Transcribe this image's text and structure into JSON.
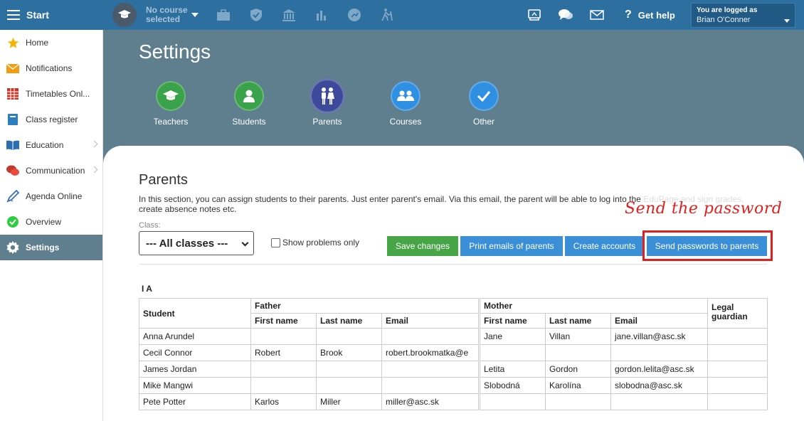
{
  "topbar": {
    "start_label": "Start",
    "course_line1": "No course",
    "course_line2": "selected",
    "help_label": "Get help",
    "login_line1": "You are logged as",
    "login_line2": "Brian O'Conner"
  },
  "sidebar": {
    "items": [
      {
        "label": "Home",
        "icon": "star-icon"
      },
      {
        "label": "Notifications",
        "icon": "envelope-icon"
      },
      {
        "label": "Timetables Onl...",
        "icon": "calendar-icon"
      },
      {
        "label": "Class register",
        "icon": "notebook-icon"
      },
      {
        "label": "Education",
        "icon": "book-icon"
      },
      {
        "label": "Communication",
        "icon": "chat-icon"
      },
      {
        "label": "Agenda Online",
        "icon": "pen-icon"
      },
      {
        "label": "Overview",
        "icon": "check-circle-icon"
      },
      {
        "label": "Settings",
        "icon": "gear-icon"
      }
    ]
  },
  "header": {
    "title": "Settings",
    "categories": [
      {
        "label": "Teachers",
        "icon": "graduation-cap-icon",
        "color": "#3aa24a"
      },
      {
        "label": "Students",
        "icon": "person-icon",
        "color": "#3aa24a"
      },
      {
        "label": "Parents",
        "icon": "parents-icon",
        "color": "#3d4a9c"
      },
      {
        "label": "Courses",
        "icon": "group-icon",
        "color": "#2f8fe0"
      },
      {
        "label": "Other",
        "icon": "checkmark-icon",
        "color": "#2f8fe0"
      }
    ]
  },
  "content": {
    "title": "Parents",
    "description_main": "In this section, you can assign students to their parents. Just enter parent's email. Via this email, the parent will be able to log into the ",
    "description_faded": "EduPage and sign grades,",
    "description_line2": "create absence notes etc.",
    "class_label": "Class:",
    "class_value": "--- All classes ---",
    "show_problems_label": "Show problems only",
    "buttons": {
      "save": "Save changes",
      "print": "Print emails of parents",
      "create": "Create accounts",
      "send": "Send passwords to parents"
    },
    "annotation": "Send the password",
    "group_title": "I A"
  },
  "table": {
    "headers": {
      "student": "Student",
      "father": "Father",
      "mother": "Mother",
      "legal": "Legal guardian",
      "first": "First name",
      "last": "Last name",
      "email": "Email"
    },
    "rows": [
      {
        "student": "Anna Arundel",
        "f_first": "",
        "f_last": "",
        "f_email": "",
        "m_first": "Jane",
        "m_last": "Villan",
        "m_email": "jane.villan@asc.sk"
      },
      {
        "student": "Cecil Connor",
        "f_first": "Robert",
        "f_last": "Brook",
        "f_email": "robert.brookmatka@e",
        "m_first": "",
        "m_last": "",
        "m_email": ""
      },
      {
        "student": "James Jordan",
        "f_first": "",
        "f_last": "",
        "f_email": "",
        "m_first": "Letita",
        "m_last": "Gordon",
        "m_email": "gordon.lelita@asc.sk"
      },
      {
        "student": "Mike Mangwi",
        "f_first": "",
        "f_last": "",
        "f_email": "",
        "m_first": "Slobodná",
        "m_last": "Karolína",
        "m_email": "slobodna@asc.sk"
      },
      {
        "student": "Pete Potter",
        "f_first": "Karlos",
        "f_last": "Miller",
        "f_email": "miller@asc.sk",
        "m_first": "",
        "m_last": "",
        "m_email": ""
      }
    ]
  },
  "colors": {
    "topbar": "#2d6f9e",
    "header_bg": "#5f7f8f",
    "save_button": "#47a447",
    "action_button": "#3b8fd6",
    "annotation": "#e0201f"
  }
}
